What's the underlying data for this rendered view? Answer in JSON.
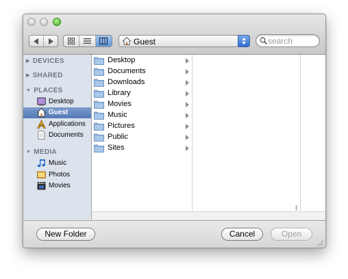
{
  "toolbar": {
    "location": "Guest",
    "search_placeholder": "search",
    "active_view": "columns"
  },
  "sidebar": {
    "sections": [
      {
        "label": "DEVICES",
        "expanded": false
      },
      {
        "label": "SHARED",
        "expanded": false
      },
      {
        "label": "PLACES",
        "expanded": true
      },
      {
        "label": "MEDIA",
        "expanded": true
      }
    ],
    "places": [
      {
        "label": "Desktop",
        "icon": "desktop-icon"
      },
      {
        "label": "Guest",
        "icon": "home-icon",
        "selected": true
      },
      {
        "label": "Applications",
        "icon": "applications-icon"
      },
      {
        "label": "Documents",
        "icon": "document-icon"
      }
    ],
    "media": [
      {
        "label": "Music",
        "icon": "music-note-icon"
      },
      {
        "label": "Photos",
        "icon": "photos-icon"
      },
      {
        "label": "Movies",
        "icon": "clapper-icon"
      }
    ]
  },
  "files": [
    "Desktop",
    "Documents",
    "Downloads",
    "Library",
    "Movies",
    "Music",
    "Pictures",
    "Public",
    "Sites"
  ],
  "buttons": {
    "new_folder": "New Folder",
    "cancel": "Cancel",
    "open": "Open"
  },
  "colors": {
    "sidebar_bg": "#dce3ec",
    "selection": "#5279b6",
    "folder_blue": "#8fb4de"
  }
}
